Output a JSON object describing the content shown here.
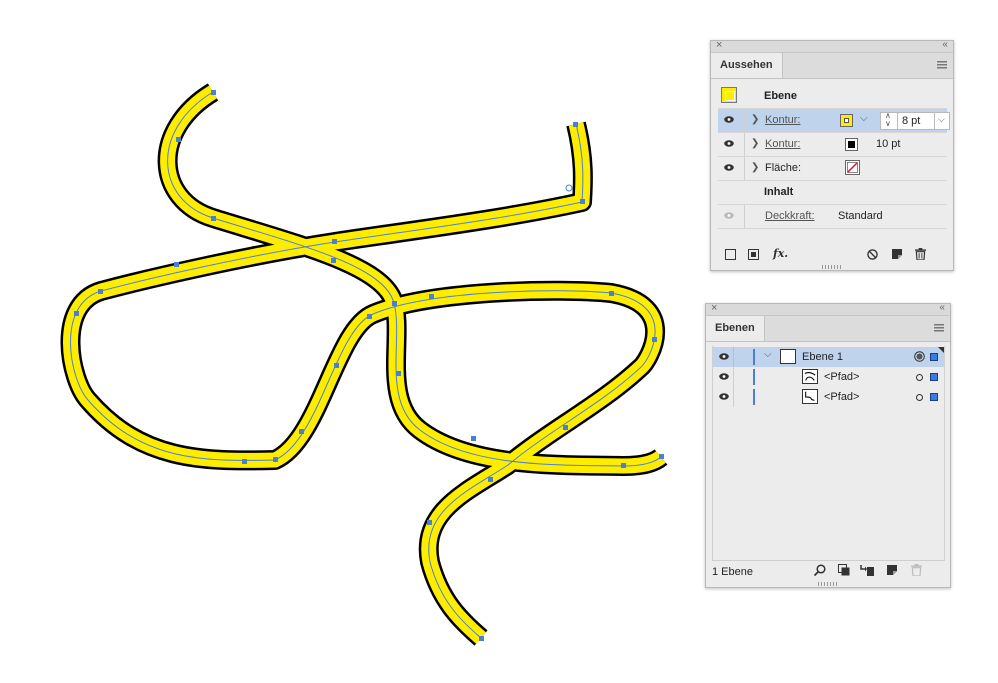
{
  "colors": {
    "stroke_yellow": "#ffed00",
    "stroke_black": "#000000",
    "path_blue": "#4a7fd6",
    "selection_row": "#bfd3ed",
    "panel_bg": "#ececec"
  },
  "appearance_panel": {
    "tab_label": "Aussehen",
    "close_icon": "×",
    "collapse_icon": "‹‹",
    "header_label": "Ebene",
    "rows": [
      {
        "label": "Kontur:",
        "value": "8 pt",
        "swatch": "yellow"
      },
      {
        "label": "Kontur:",
        "value": "10 pt",
        "swatch": "black"
      },
      {
        "label": "Fläche:",
        "swatch": "none"
      },
      {
        "label": "Inhalt"
      },
      {
        "label": "Deckkraft:",
        "value": "Standard"
      }
    ],
    "fx_label": "fx."
  },
  "layers_panel": {
    "tab_label": "Ebenen",
    "close_icon": "×",
    "collapse_icon": "‹‹",
    "layers": [
      {
        "name": "Ebene 1"
      },
      {
        "name": "<Pfad>"
      },
      {
        "name": "<Pfad>"
      }
    ],
    "footer_label": "1 Ebene"
  }
}
